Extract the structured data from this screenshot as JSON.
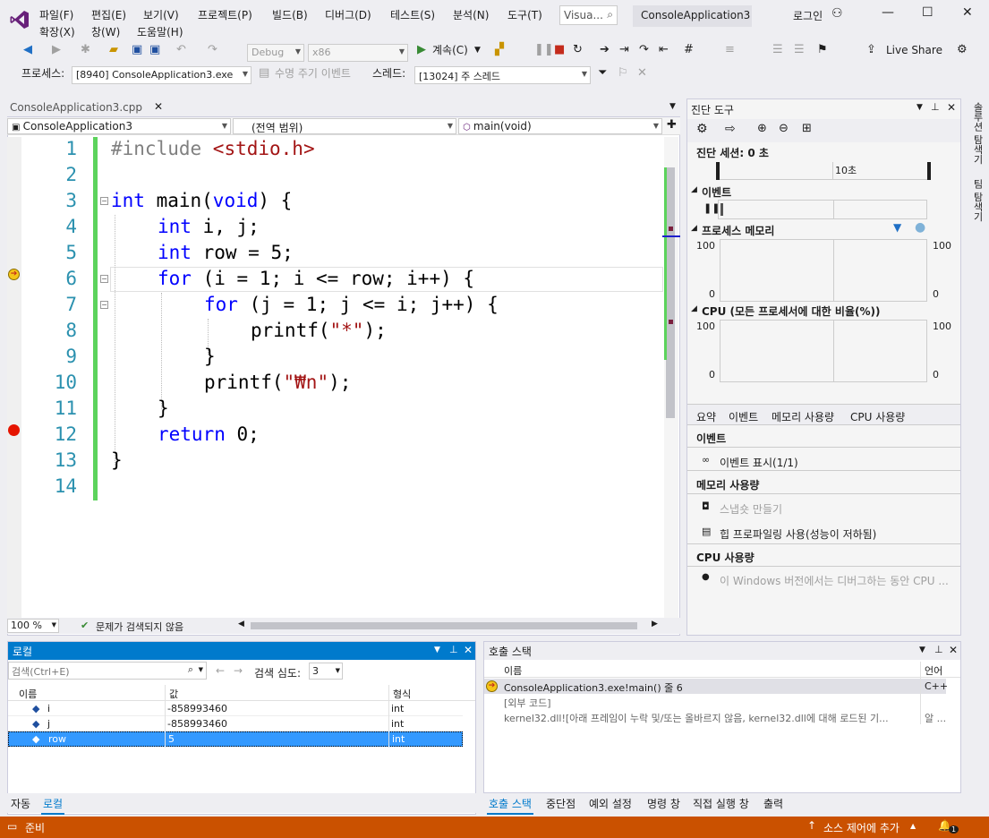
{
  "menu": {
    "file": "파일(F)",
    "edit": "편집(E)",
    "view": "보기(V)",
    "project": "프로젝트(P)",
    "build": "빌드(B)",
    "debug": "디버그(D)",
    "test": "테스트(S)",
    "analyze": "분석(N)",
    "tools": "도구(T)",
    "extensions": "확장(X)",
    "window": "창(W)",
    "help": "도움말(H)"
  },
  "title": {
    "search_placeholder": "Visua...",
    "app_title": "ConsoleApplication3",
    "login": "로그인"
  },
  "toolbar": {
    "config": "Debug",
    "platform": "x86",
    "continue": "계속(C)",
    "live_share": "Live Share",
    "process_label": "프로세스:",
    "process_value": "[8940] ConsoleApplication3.exe",
    "lifecycle_events": "수명 주기 이벤트",
    "thread_label": "스레드:",
    "thread_value": "[13024] 주 스레드"
  },
  "editor": {
    "tab": "ConsoleApplication3.cpp",
    "nav_project": "ConsoleApplication3",
    "nav_scope": "(전역 범위)",
    "nav_function": "main(void)",
    "zoom": "100 %",
    "status": "문제가 검색되지 않음",
    "line_numbers": [
      "1",
      "2",
      "3",
      "4",
      "5",
      "6",
      "7",
      "8",
      "9",
      "10",
      "11",
      "12",
      "13",
      "14"
    ],
    "lines": {
      "l1_pp": "#include ",
      "l1_str": "<stdio.h>",
      "l3_kw": "int",
      "l3_a": " main(",
      "l3_kw2": "void",
      "l3_b": ") {",
      "l4_kw": "int",
      "l4_rest": " i, j;",
      "l5_kw": "int",
      "l5_rest": " row = 5;",
      "l6_kw": "for",
      "l6_rest": " (i = 1; i <= row; i++) {",
      "l7_kw": "for",
      "l7_rest": " (j = 1; j <= i; j++) {",
      "l8_a": "printf(",
      "l8_str": "\"*\"",
      "l8_b": ");",
      "l9": "}",
      "l10_a": "printf(",
      "l10_str": "\"₩n\"",
      "l10_b": ");",
      "l11": "}",
      "l12_kw": "return",
      "l12_rest": " 0;",
      "l13": "}"
    }
  },
  "diagnostics": {
    "title": "진단 도구",
    "session": "진단 세션: 0 초",
    "timeline_tick": "10초",
    "events": "이벤트",
    "process_memory": "프로세스 메모리",
    "mem_max": "100",
    "mem_min": "0",
    "cpu": "CPU (모든 프로세서에 대한 비율(%))",
    "cpu_max": "100",
    "cpu_min": "0",
    "tabs": [
      "요약",
      "이벤트",
      "메모리 사용량",
      "CPU 사용량"
    ],
    "events_section": "이벤트",
    "show_events": "이벤트 표시(1/1)",
    "memory_section": "메모리 사용량",
    "take_snapshot": "스냅숏 만들기",
    "heap_profiling": "힙 프로파일링 사용(성능이 저하됨)",
    "cpu_section": "CPU 사용량",
    "cpu_note": "이 Windows 버전에서는 디버그하는 동안 CPU ...",
    "side_tab_1": "솔루션 탐색기",
    "side_tab_2": "팀 탐색기"
  },
  "locals": {
    "title": "로컬",
    "search_placeholder": "검색(Ctrl+E)",
    "depth_label": "검색 심도:",
    "depth_value": "3",
    "columns": [
      "이름",
      "값",
      "형식"
    ],
    "rows": [
      {
        "name": "i",
        "value": "-858993460",
        "type": "int"
      },
      {
        "name": "j",
        "value": "-858993460",
        "type": "int"
      },
      {
        "name": "row",
        "value": "5",
        "type": "int"
      }
    ],
    "tabs": [
      "자동",
      "로컬"
    ]
  },
  "callstack": {
    "title": "호출 스택",
    "columns": [
      "이름",
      "언어"
    ],
    "rows": [
      {
        "name": "ConsoleApplication3.exe!main() 줄 6",
        "lang": "C++"
      },
      {
        "name": "[외부 코드]",
        "lang": ""
      },
      {
        "name": "kernel32.dll![아래 프레임이 누락 및/또는 올바르지 않음, kernel32.dll에 대해 로드된 기...",
        "lang": "알 ..."
      }
    ],
    "tabs": [
      "호출 스택",
      "중단점",
      "예외 설정",
      "명령 창",
      "직접 실행 창",
      "출력"
    ]
  },
  "statusbar": {
    "ready": "준비",
    "source_control": "소스 제어에 추가",
    "notifications": "1"
  },
  "colors": {
    "accent": "#007acc",
    "status": "#ca5100",
    "breakpoint": "#e51400",
    "changed": "#5cd35c"
  }
}
